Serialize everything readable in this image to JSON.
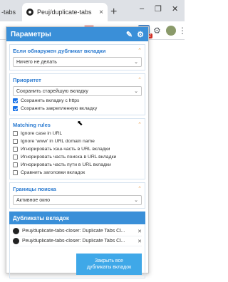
{
  "browser": {
    "partial_tab": "-tabs",
    "active_tab": "Peuj/duplicate-tabs",
    "tab_close": "×",
    "new_tab": "+",
    "win_minimize": "–",
    "win_maximize": "❐",
    "win_close": "✕",
    "badge_count": "2",
    "toolbar_icons": [
      "star-icon",
      "gmail-icon",
      "red-extension-icon",
      "m-extension-icon",
      "play-extension-icon",
      "puzzle-icon",
      "duplicate-tabs-icon",
      "gear-extension-icon",
      "avatar",
      "menu-icon"
    ]
  },
  "popup": {
    "title": "Параметры",
    "header_icons": [
      "pin-icon",
      "gear-icon"
    ],
    "accent": "#3a8fd8",
    "sections": {
      "if_found": {
        "title": "Если обнаружен дубликат вкладки",
        "select_value": "Ничего не делать"
      },
      "priority": {
        "title": "Приоритет",
        "select_value": "Сохранить старейшую вкладку",
        "checks": [
          {
            "label": "Сохранить вкладку с https",
            "checked": true
          },
          {
            "label": "Сохранить закрепленную вкладку",
            "checked": true
          }
        ]
      },
      "matching": {
        "title": "Matching rules",
        "checks": [
          {
            "label": "Ignore case in URL",
            "checked": false
          },
          {
            "label": "Ignore 'www' in URL domain name",
            "checked": false
          },
          {
            "label": "Игнорировать хэш-часть в URL вкладки",
            "checked": false
          },
          {
            "label": "Игнорировать часть поиска в URL вкладки",
            "checked": false
          },
          {
            "label": "Игнорировать часть пути в URL вкладки",
            "checked": false
          },
          {
            "label": "Сравнить заголовки вкладок",
            "checked": false
          }
        ]
      },
      "scope": {
        "title": "Границы поиска",
        "select_value": "Активное окно"
      }
    },
    "duplicates": {
      "title": "Дубликаты вкладок",
      "items": [
        "Peuj/duplicate-tabs-closer: Duplicate Tabs Cl...",
        "Peuj/duplicate-tabs-closer: Duplicate Tabs Cl..."
      ],
      "close_all_line1": "Закрыть все",
      "close_all_line2": "дубликаты вкладок"
    }
  }
}
